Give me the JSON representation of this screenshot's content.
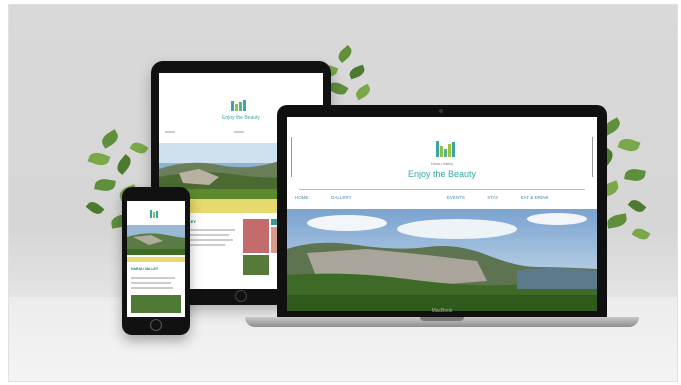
{
  "laptop": {
    "logo_text": "Harau Valley",
    "tagline": "Enjoy the Beauty",
    "nav": [
      "HOME",
      "GALLERY",
      "",
      "",
      "EVENTS",
      "STAY",
      "EAT & DRINK",
      ""
    ],
    "brand": "MacBook"
  },
  "tablet": {
    "tagline": "Enjoy the Beauty",
    "heading": "HARAU VALLEY"
  },
  "phone": {
    "heading": "HARAU VALLEY"
  },
  "colors": {
    "accent": "#34a9a4",
    "band": "#e7d96d"
  }
}
